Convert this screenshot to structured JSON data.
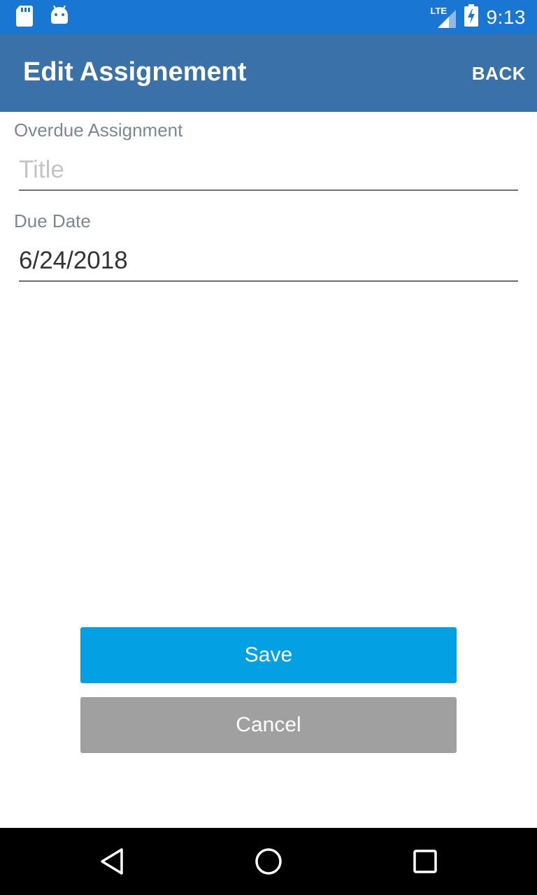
{
  "colors": {
    "status_bar": "#1976d2",
    "app_bar": "#3a71a8",
    "save_button": "#03a1e4",
    "cancel_button": "#a0a0a0",
    "label_text": "#7b8794",
    "placeholder_text": "#c4c4c4"
  },
  "status_bar": {
    "left_icons": [
      "sd-card-icon",
      "android-icon"
    ],
    "network_label": "LTE",
    "right_icons": [
      "signal-icon",
      "battery-charging-icon"
    ],
    "time": "9:13"
  },
  "app_bar": {
    "title": "Edit Assignement",
    "back_label": "BACK"
  },
  "form": {
    "title_section_label": "Overdue Assignment",
    "title_input": {
      "placeholder": "Title",
      "value": ""
    },
    "due_date_label": "Due Date",
    "due_date_value": "6/24/2018"
  },
  "buttons": {
    "save_label": "Save",
    "cancel_label": "Cancel"
  },
  "nav_bar": {
    "icons": [
      "back-triangle-icon",
      "home-circle-icon",
      "recents-square-icon"
    ]
  }
}
